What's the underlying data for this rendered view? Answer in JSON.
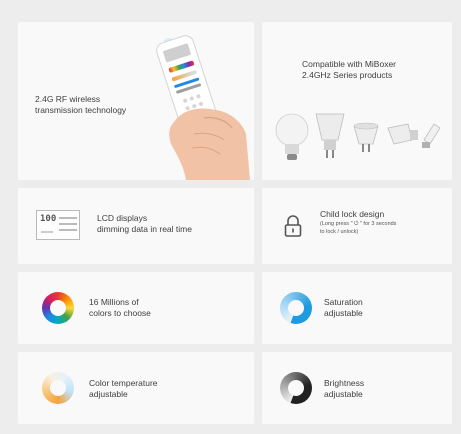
{
  "features": {
    "rf": {
      "line1": "2.4G RF wireless",
      "line2": "transmission technology"
    },
    "compat": {
      "line1": "Compatible with MiBoxer",
      "line2": "2.4GHz Series products"
    },
    "lcd": {
      "line1": "LCD displays",
      "line2": "dimming data in real time",
      "screen_value": "100"
    },
    "child_lock": {
      "title": "Child lock design",
      "note1": "(Long press \" ⏻ \" for 3 seconds",
      "note2": "to lock / unlock)"
    },
    "colors": {
      "line1": "16 Millions of",
      "line2": "colors to choose"
    },
    "saturation": {
      "line1": "Saturation",
      "line2": "adjustable"
    },
    "color_temp": {
      "line1": "Color temperature",
      "line2": "adjustable"
    },
    "brightness": {
      "line1": "Brightness",
      "line2": "adjustable"
    }
  },
  "colors": {
    "background": "#ededed",
    "card": "#f9f9f9",
    "saturation_ring": "#1e9ae0",
    "brightness_ring": "#222222",
    "warm": "#f4a23a",
    "cool": "#bfe2f7"
  },
  "icons": [
    "remote-in-hand-image",
    "bulb-icons",
    "lcd-screen-icon",
    "lock-icon",
    "color-wheel-icon",
    "saturation-ring-icon",
    "color-temperature-ring-icon",
    "brightness-ring-icon"
  ]
}
